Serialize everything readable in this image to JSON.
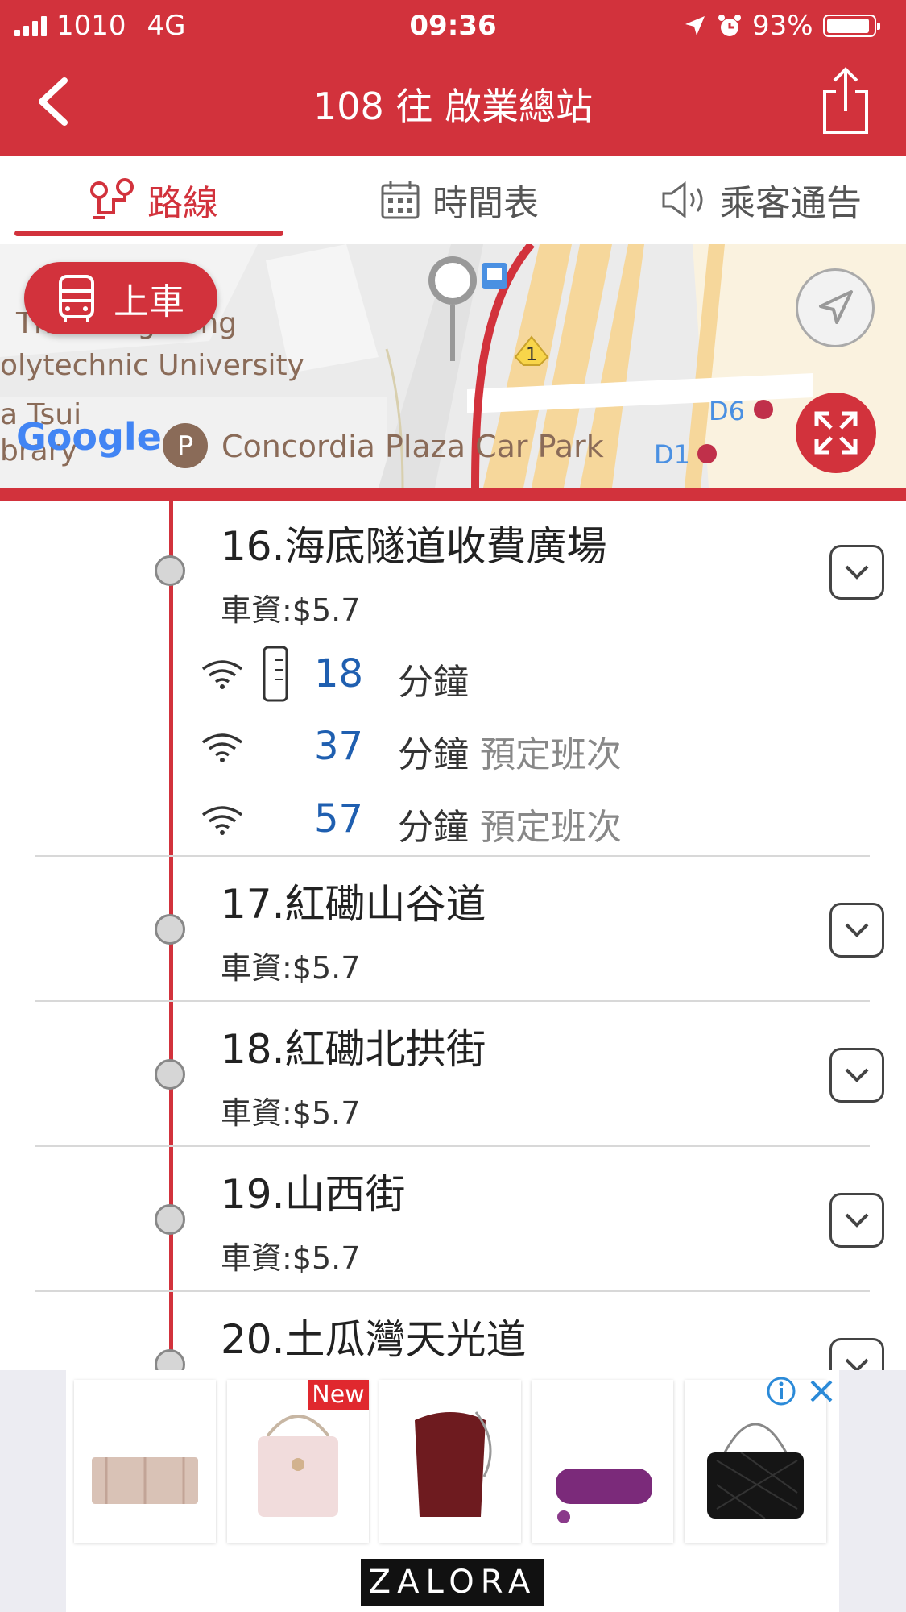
{
  "status_bar": {
    "carrier": "1010",
    "network": "4G",
    "time": "09:36",
    "battery": "93%"
  },
  "header": {
    "title": "108 往 啟業總站",
    "back_icon": "chevron-left-icon",
    "share_icon": "share-icon"
  },
  "tabs": [
    {
      "label": "路線",
      "icon": "route-icon",
      "active": true
    },
    {
      "label": "時間表",
      "icon": "calendar-icon",
      "active": false
    },
    {
      "label": "乘客通告",
      "icon": "speaker-icon",
      "active": false
    }
  ],
  "map": {
    "board_button": "上車",
    "labels": {
      "poly1": "The Hong Kong",
      "poly2": "olytechnic University",
      "tsui1": "a Tsui",
      "tsui2": "brary",
      "parking": "Concordia Plaza Car Park",
      "d6": "D6",
      "d1": "D1",
      "route_marker": "1",
      "google": "Google",
      "parking_p": "P"
    }
  },
  "stops": [
    {
      "name": "16.海底隧道收費廣場",
      "fare": "車資:$5.7",
      "etas": [
        {
          "minutes": "18",
          "unit": "分鐘",
          "note": ""
        },
        {
          "minutes": "37",
          "unit": "分鐘",
          "note": "預定班次"
        },
        {
          "minutes": "57",
          "unit": "分鐘",
          "note": "預定班次"
        }
      ]
    },
    {
      "name": "17.紅磡山谷道",
      "fare": "車資:$5.7"
    },
    {
      "name": "18.紅磡北拱街",
      "fare": "車資:$5.7"
    },
    {
      "name": "19.山西街",
      "fare": "車資:$5.7"
    },
    {
      "name": "20.土瓜灣天光道",
      "fare": ""
    }
  ],
  "ad": {
    "badge": "New",
    "brand": "ZALORA",
    "info_icon": "info-icon",
    "close_icon": "close-icon"
  },
  "colors": {
    "brand_red": "#d2323c",
    "eta_blue": "#1f5fb0"
  }
}
